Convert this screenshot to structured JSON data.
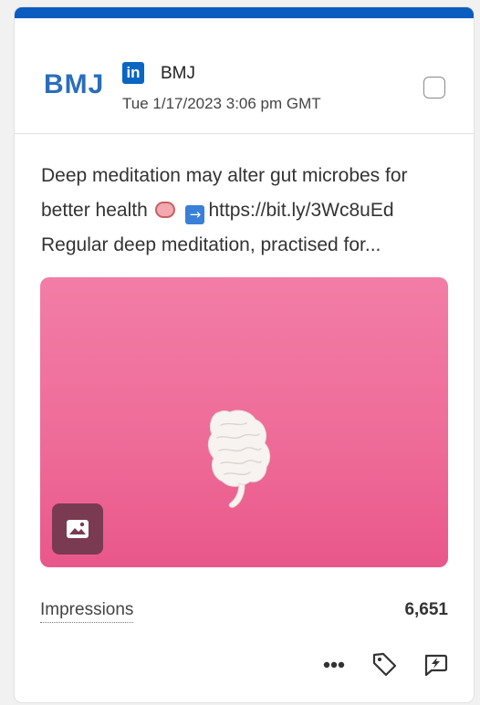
{
  "header": {
    "logo_text": "BMJ",
    "network_badge": "in",
    "account_name": "BMJ",
    "timestamp": "Tue 1/17/2023 3:06 pm GMT"
  },
  "post": {
    "line1": "Deep meditation may alter gut microbes for",
    "line2_prefix": "better health",
    "line2_link": "https://bit.ly/3Wc8uEd",
    "line3": "Regular deep meditation, practised for...",
    "emoji_brain": "brain-emoji",
    "emoji_arrow": "→"
  },
  "media": {
    "type": "image",
    "badge_icon": "image-icon"
  },
  "metrics": {
    "label": "Impressions",
    "value": "6,651"
  },
  "actions": [
    "more-icon",
    "tag-icon",
    "comment-bolt-icon"
  ],
  "colors": {
    "accent_bar": "#0b5cbf",
    "linkedin": "#0a66c2",
    "bmj_logo": "#2a6ebb",
    "media_bg": "#ee6a97"
  }
}
